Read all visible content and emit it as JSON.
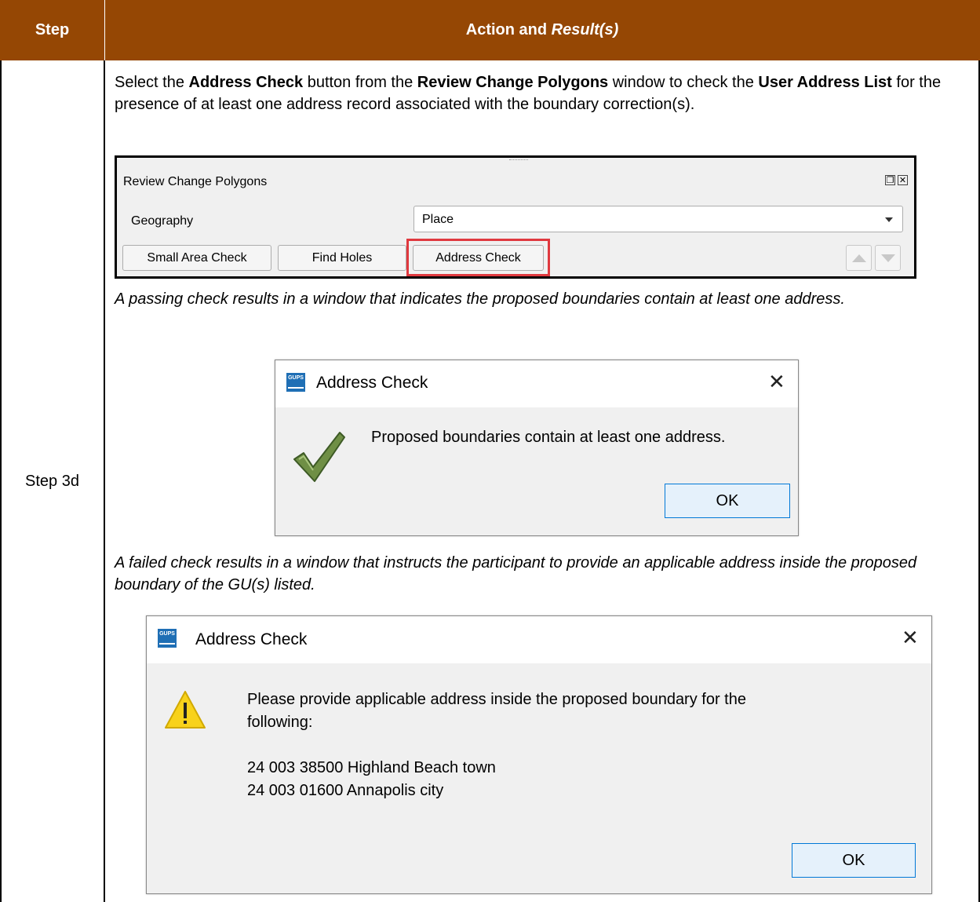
{
  "table": {
    "header_step": "Step",
    "header_action": "Action and ",
    "header_result": "Result(s)",
    "step_label": "Step 3d"
  },
  "instruction": {
    "p1": "Select the ",
    "b1": "Address Check",
    "p2": " button from the ",
    "b2": "Review Change Polygons",
    "p3": " window to check the ",
    "b3": "User Address List",
    "p4": " for the presence of at least one address record associated with the boundary correction(s)."
  },
  "review_panel": {
    "title": "Review Change Polygons",
    "geography_label": "Geography",
    "geography_value": "Place",
    "buttons": [
      "Small Area Check",
      "Find Holes",
      "Address Check"
    ],
    "highlight_color": "#e0393f"
  },
  "pass_note": "A passing check results in a window that indicates the proposed boundaries contain at least one address.",
  "pass_dialog": {
    "app_icon_text": "GUPS",
    "title": "Address Check",
    "message": "Proposed boundaries contain at least one address.",
    "icon": "checkmark-icon",
    "ok": "OK"
  },
  "fail_note": "A failed check results in a window that instructs the participant to provide an applicable address inside the proposed boundary of the GU(s) listed.",
  "fail_dialog": {
    "app_icon_text": "GUPS",
    "title": "Address Check",
    "message_line1": "Please provide applicable address inside the proposed boundary for the",
    "message_line2": "following:",
    "entries": [
      "24 003 38500 Highland Beach town",
      "24 003 01600 Annapolis city"
    ],
    "icon": "warning-icon",
    "ok": "OK"
  },
  "colors": {
    "header_bg": "#954704",
    "ok_button_bg": "#e5f1fb",
    "ok_button_border": "#0078d7"
  }
}
